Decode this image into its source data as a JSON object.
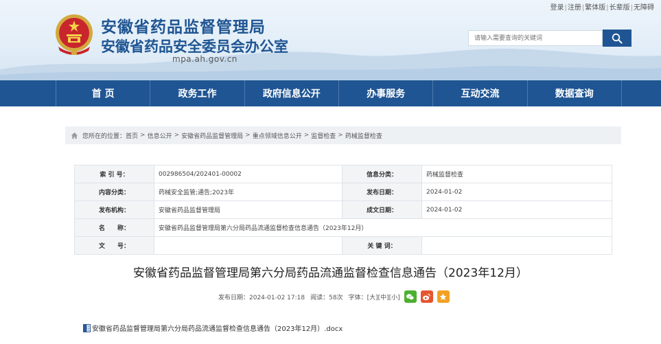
{
  "top_links": [
    "登录",
    "注册",
    "繁体版",
    "长辈版",
    "无障碍"
  ],
  "site": {
    "title_line1": "安徽省药品监督管理局",
    "title_line2": "安徽省药品安全委员会办公室",
    "domain": "mpa.ah.gov.cn"
  },
  "search": {
    "placeholder": "请输入需要查询的关键词"
  },
  "nav": [
    "首 页",
    "政务工作",
    "政府信息公开",
    "办事服务",
    "互动交流",
    "数据查询"
  ],
  "breadcrumb": {
    "prefix": "您所在的位置：",
    "items": [
      "首页",
      "信息公开",
      "安徽省药品监督管理局",
      "重点领域信息公开",
      "监督检查",
      "药械监督检查"
    ]
  },
  "info": {
    "index_label": "索 引 号：",
    "index_value": "002986504/202401-00002",
    "category_label": "信息分类：",
    "category_value": "药械监督检查",
    "content_label": "内容分类：",
    "content_value": "药械安全监管;通告;2023年",
    "pub_date_label": "发布日期：",
    "pub_date_value": "2024-01-02",
    "org_label": "发布机构：",
    "org_value": "安徽省药品监督管理局",
    "made_date_label": "成文日期：",
    "made_date_value": "2024-01-02",
    "name_label": "名　　称：",
    "name_value": "安徽省药品监督管理局第六分局药品流通监督检查信息通告（2023年12月）",
    "doc_label": "文　　号：",
    "doc_value": "",
    "keyword_label": "关 键 词：",
    "keyword_value": ""
  },
  "article": {
    "title": "安徽省药品监督管理局第六分局药品流通监督检查信息通告（2023年12月）",
    "published": "发布日期：2024-01-02 17:18",
    "reads": "阅读：58次",
    "font_label": "字体：",
    "font_large": "[大]",
    "font_medium": "[中]",
    "font_small": "[小]"
  },
  "attachment": {
    "name": "安徽省药品监督管理局第六分局药品流通监督检查信息通告（2023年12月）.docx"
  },
  "colors": {
    "brand": "#1f5592",
    "wechat": "#4cb030",
    "weibo": "#e6552e",
    "favorite": "#f3a123"
  }
}
